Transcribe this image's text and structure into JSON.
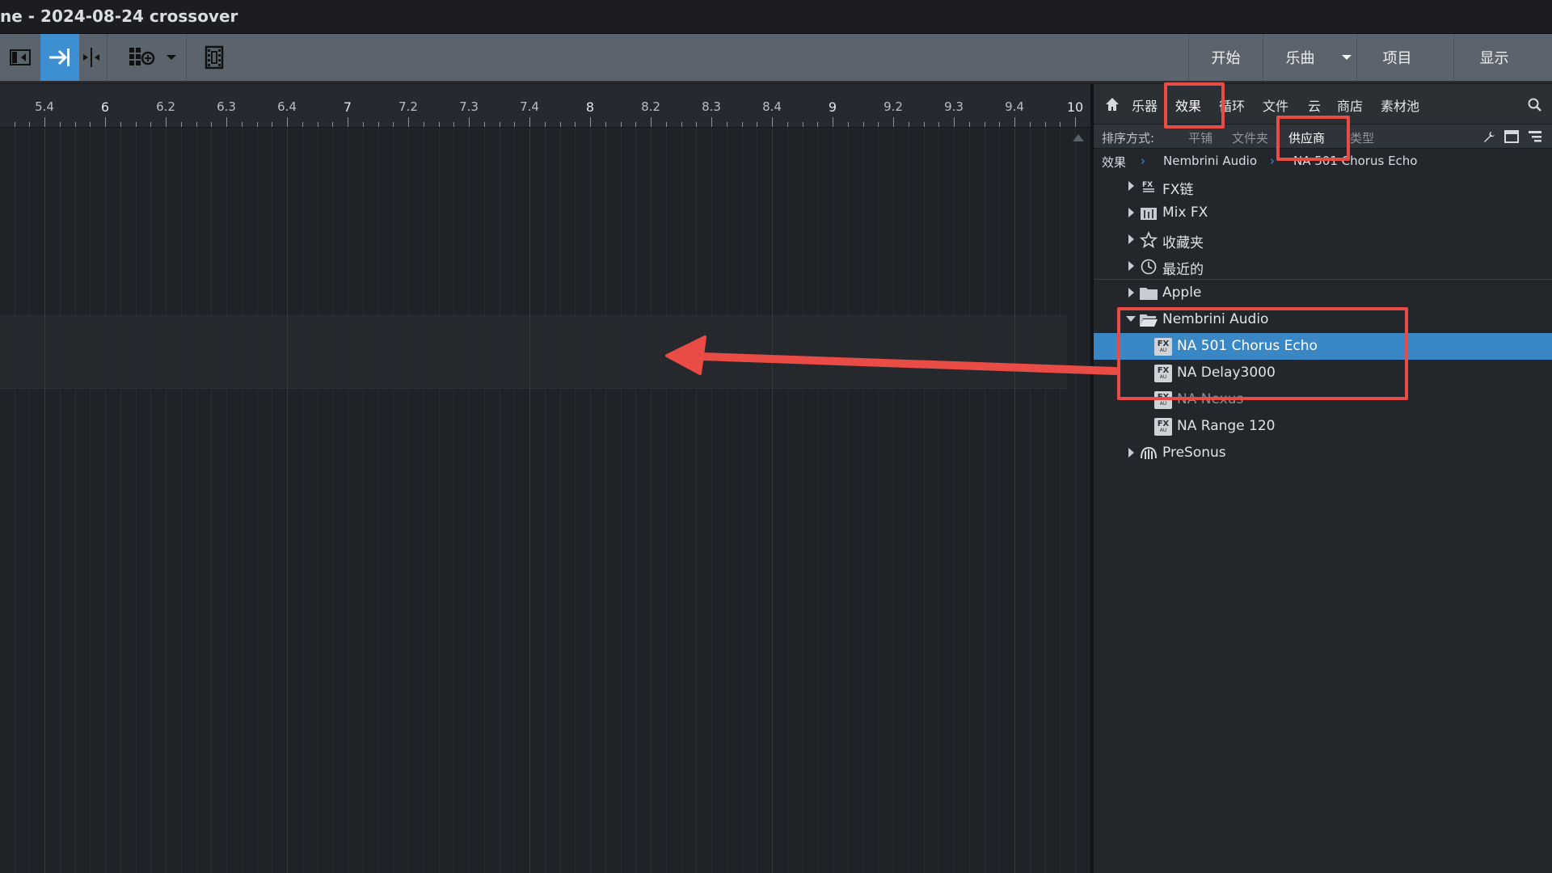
{
  "window": {
    "title": "ne - 2024-08-24 crossover"
  },
  "toolbar": {
    "right_buttons": [
      "开始",
      "乐曲",
      "项目",
      "显示"
    ]
  },
  "ruler": {
    "labels": [
      {
        "text": "5.4",
        "major": false
      },
      {
        "text": "6",
        "major": true
      },
      {
        "text": "6.2",
        "major": false
      },
      {
        "text": "6.3",
        "major": false
      },
      {
        "text": "6.4",
        "major": false
      },
      {
        "text": "7",
        "major": true
      },
      {
        "text": "7.2",
        "major": false
      },
      {
        "text": "7.3",
        "major": false
      },
      {
        "text": "7.4",
        "major": false
      },
      {
        "text": "8",
        "major": true
      },
      {
        "text": "8.2",
        "major": false
      },
      {
        "text": "8.3",
        "major": false
      },
      {
        "text": "8.4",
        "major": false
      },
      {
        "text": "9",
        "major": true
      },
      {
        "text": "9.2",
        "major": false
      },
      {
        "text": "9.3",
        "major": false
      },
      {
        "text": "9.4",
        "major": false
      },
      {
        "text": "10",
        "major": true
      }
    ]
  },
  "browser": {
    "tabs": [
      "乐器",
      "效果",
      "循环",
      "文件",
      "云",
      "商店",
      "素材池"
    ],
    "active_tab": "效果",
    "sort": {
      "label": "排序方式:",
      "options": [
        "平铺",
        "文件夹",
        "供应商",
        "类型"
      ],
      "active": "供应商"
    },
    "breadcrumb": [
      "效果",
      "Nembrini Audio",
      "NA 501 Chorus Echo"
    ],
    "tree": [
      {
        "label": "FX链",
        "icon": "fx-chain-icon",
        "indent": 0,
        "arrow": "closed"
      },
      {
        "label": "Mix FX",
        "icon": "mix-fx-icon",
        "indent": 0,
        "arrow": "closed"
      },
      {
        "label": "收藏夹",
        "icon": "star-icon",
        "indent": 0,
        "arrow": "closed"
      },
      {
        "label": "最近的",
        "icon": "clock-icon",
        "indent": 0,
        "arrow": "closed"
      },
      {
        "label": "Apple",
        "icon": "folder-icon",
        "indent": 0,
        "arrow": "closed"
      },
      {
        "label": "Nembrini Audio",
        "icon": "folder-open-icon",
        "indent": 0,
        "arrow": "open"
      },
      {
        "label": "NA 501 Chorus Echo",
        "icon": "fx-au-icon",
        "indent": 1,
        "selected": true
      },
      {
        "label": "NA Delay3000",
        "icon": "fx-au-icon",
        "indent": 1
      },
      {
        "label": "NA Nexus",
        "icon": "fx-au-icon",
        "indent": 1,
        "faded": true
      },
      {
        "label": "NA Range 120",
        "icon": "fx-au-icon",
        "indent": 1
      },
      {
        "label": "PreSonus",
        "icon": "presonus-icon",
        "indent": 0,
        "arrow": "closed"
      }
    ]
  },
  "colors": {
    "accent": "#3d8fd1",
    "annotation": "#e84c45",
    "selection": "#3a87c6"
  }
}
